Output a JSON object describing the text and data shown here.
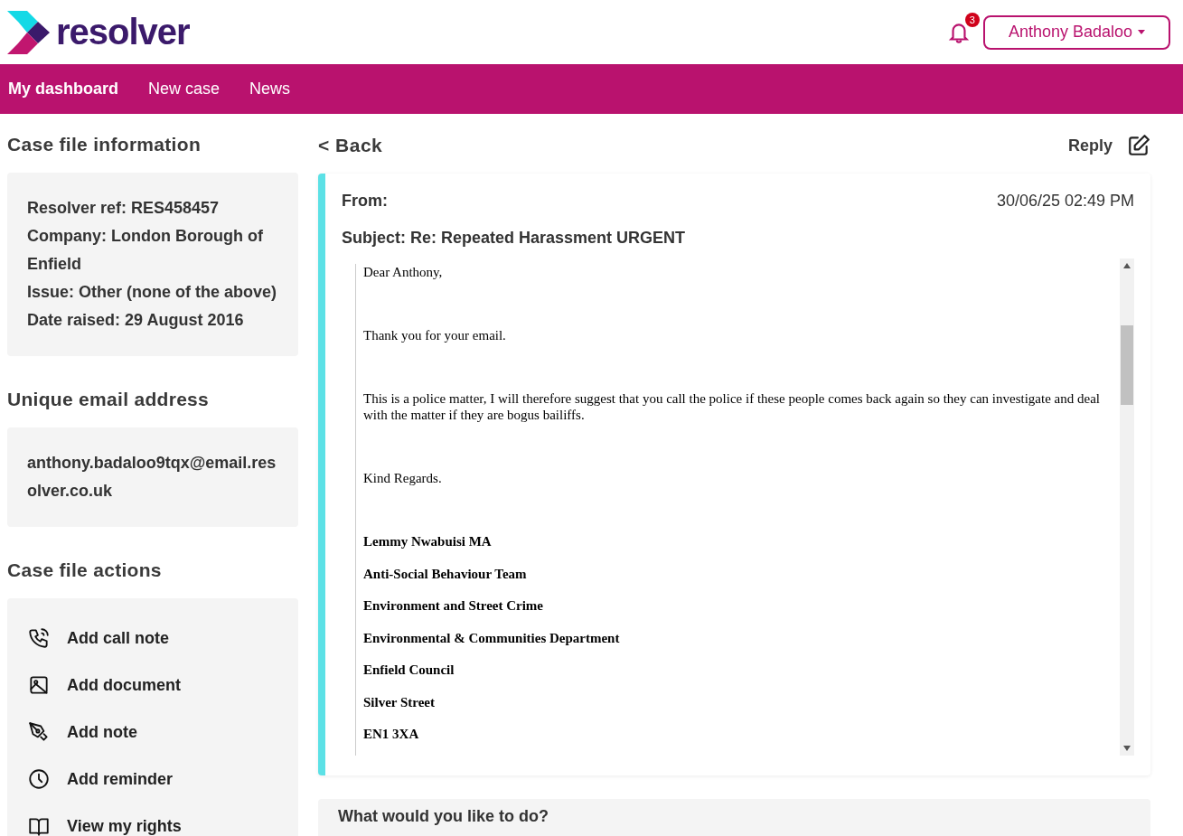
{
  "header": {
    "logo_text": "resolver",
    "notifications": {
      "count": "3"
    },
    "user_menu": {
      "label": "Anthony Badaloo"
    }
  },
  "nav": [
    {
      "label": "My dashboard",
      "selected": true
    },
    {
      "label": "New case",
      "selected": false
    },
    {
      "label": "News",
      "selected": false
    }
  ],
  "sidebar": {
    "case_info": {
      "title": "Case file information",
      "lines": [
        "Resolver ref: RES458457",
        "Company: London Borough of Enfield",
        "Issue: Other (none of the above)",
        "Date raised: 29 August 2016"
      ]
    },
    "email": {
      "title": "Unique email address",
      "address": "anthony.badaloo9tqx@email.resolver.co.uk"
    },
    "actions": {
      "title": "Case file actions",
      "items": [
        {
          "kind": "call",
          "label": "Add call note"
        },
        {
          "kind": "document",
          "label": "Add document"
        },
        {
          "kind": "note",
          "label": "Add note"
        },
        {
          "kind": "reminder",
          "label": "Add reminder"
        },
        {
          "kind": "rights",
          "label": "View my rights"
        }
      ]
    }
  },
  "message": {
    "back": "< Back",
    "reply": "Reply",
    "from": "From:",
    "date": "30/06/25 02:49 PM",
    "subject": "Subject: Re: Repeated Harassment URGENT",
    "body": [
      {
        "kind": "text",
        "text": "Dear Anthony,"
      },
      {
        "kind": "text",
        "text": "Thank you for your email."
      },
      {
        "kind": "text",
        "text": "This is a police matter, I will therefore suggest that you call the police if these people comes back again so they can investigate and deal with the matter if they are bogus bailiffs."
      },
      {
        "kind": "text",
        "text": "Kind Regards."
      },
      {
        "kind": "signature",
        "text": "Lemmy Nwabuisi MA"
      },
      {
        "kind": "signature",
        "text": "Anti-Social Behaviour Team"
      },
      {
        "kind": "signature",
        "text": "Environment and Street Crime"
      },
      {
        "kind": "signature",
        "text": "Environmental & Communities Department"
      },
      {
        "kind": "signature",
        "text": "Enfield Council"
      },
      {
        "kind": "signature",
        "text": "Silver Street"
      },
      {
        "kind": "signature",
        "text": "EN1 3XA"
      }
    ]
  },
  "next_panel": {
    "title": "What would you like to do?"
  }
}
